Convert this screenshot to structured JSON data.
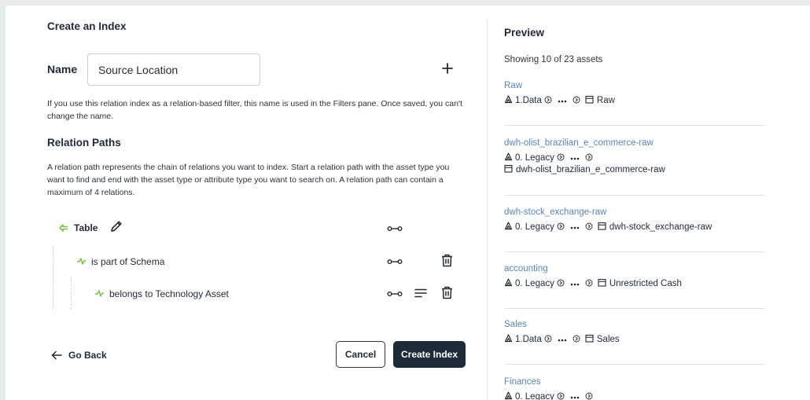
{
  "form": {
    "title": "Create an Index",
    "name_label": "Name",
    "name_value": "Source Location",
    "name_help": "If you use this relation index as a relation-based filter, this name is used in the Filters pane. Once saved, you can't change the name.",
    "relation_paths_title": "Relation Paths",
    "relation_paths_desc": "A relation path represents the chain of relations you want to index. Start a relation path with the asset type you want to find and end with the asset type or attribute type you want to search on. A relation path can contain a maximum of 4 relations.",
    "root_label": "Table",
    "relations": [
      "is part of Schema",
      "belongs to Technology Asset"
    ],
    "go_back_label": "Go Back",
    "cancel_label": "Cancel",
    "create_label": "Create Index"
  },
  "preview": {
    "title": "Preview",
    "showing": "Showing 10 of 23 assets",
    "assets": [
      {
        "title": "Raw",
        "line1": "1.Data",
        "line2": "Raw",
        "wrap": false
      },
      {
        "title": "dwh-olist_brazilian_e_commerce-raw",
        "line1": "0. Legacy",
        "line2": "dwh-olist_brazilian_e_commerce-raw",
        "wrap": true
      },
      {
        "title": "dwh-stock_exchange-raw",
        "line1": "0. Legacy",
        "line2": "dwh-stock_exchange-raw",
        "wrap": false
      },
      {
        "title": "accounting",
        "line1": "0. Legacy",
        "line2": "Unrestricted Cash",
        "wrap": false
      },
      {
        "title": "Sales",
        "line1": "1.Data",
        "line2": "Sales",
        "wrap": false
      },
      {
        "title": "Finances",
        "line1": "0. Legacy",
        "line2": "",
        "wrap": false
      }
    ]
  },
  "colors": {
    "link": "#5b83b8",
    "primary_button": "#1d2a38",
    "relation_icon": "#7cc243"
  },
  "icons": {
    "add": "plus-icon",
    "edit": "pencil-icon",
    "delete": "trash-icon",
    "relation": "relation-connector-icon",
    "filter": "lines-icon",
    "back": "arrow-left-icon"
  }
}
